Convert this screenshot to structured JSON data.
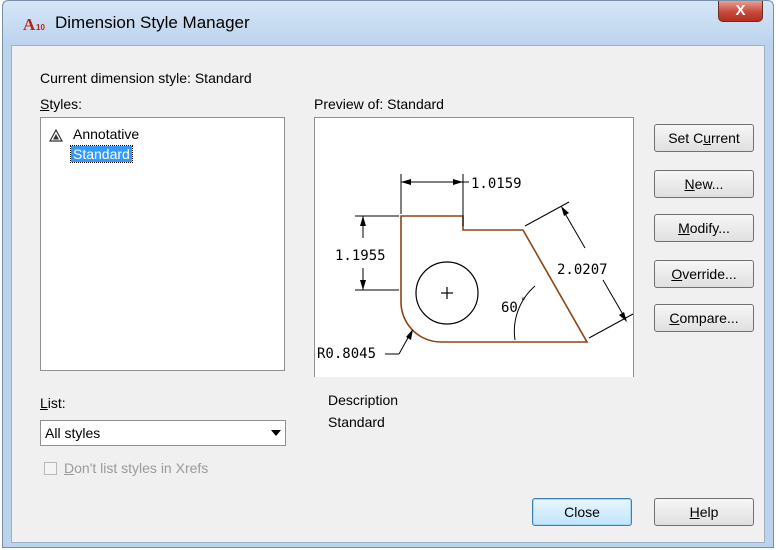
{
  "window": {
    "title": "Dimension Style Manager",
    "close_glyph": "X",
    "app_icon_text": "A",
    "app_icon_sub": "10"
  },
  "current_style": {
    "label": "Current dimension style: Standard"
  },
  "styles": {
    "label_u": "S",
    "label_rest": "tyles:",
    "items": [
      {
        "label": "Annotative",
        "icon": "annotative-icon",
        "selected": false
      },
      {
        "label": "Standard",
        "icon": null,
        "selected": true
      }
    ]
  },
  "list": {
    "label_u": "L",
    "label_rest": "ist:",
    "selected": "All styles"
  },
  "xrefs_checkbox": {
    "label_u": "D",
    "label_rest": "on't list styles in Xrefs",
    "checked": false,
    "enabled": false
  },
  "preview": {
    "label": "Preview of: Standard",
    "dims": {
      "top": "1.0159",
      "left": "1.1955",
      "diag": "2.0207",
      "angle": "60",
      "radius": "R0.8045"
    }
  },
  "description": {
    "label": "Description",
    "value": "Standard"
  },
  "buttons": {
    "set_current": {
      "pre": "Set C",
      "u": "u",
      "post": "rrent"
    },
    "new": {
      "pre": "",
      "u": "N",
      "post": "ew..."
    },
    "modify": {
      "pre": "",
      "u": "M",
      "post": "odify..."
    },
    "override": {
      "pre": "",
      "u": "O",
      "post": "verride..."
    },
    "compare": {
      "pre": "",
      "u": "C",
      "post": "ompare..."
    },
    "close": "Close",
    "help": {
      "pre": "",
      "u": "H",
      "post": "elp"
    }
  },
  "colors": {
    "outline": "#8b4513",
    "selection": "#3399ff",
    "close_button": "#c8483a"
  }
}
